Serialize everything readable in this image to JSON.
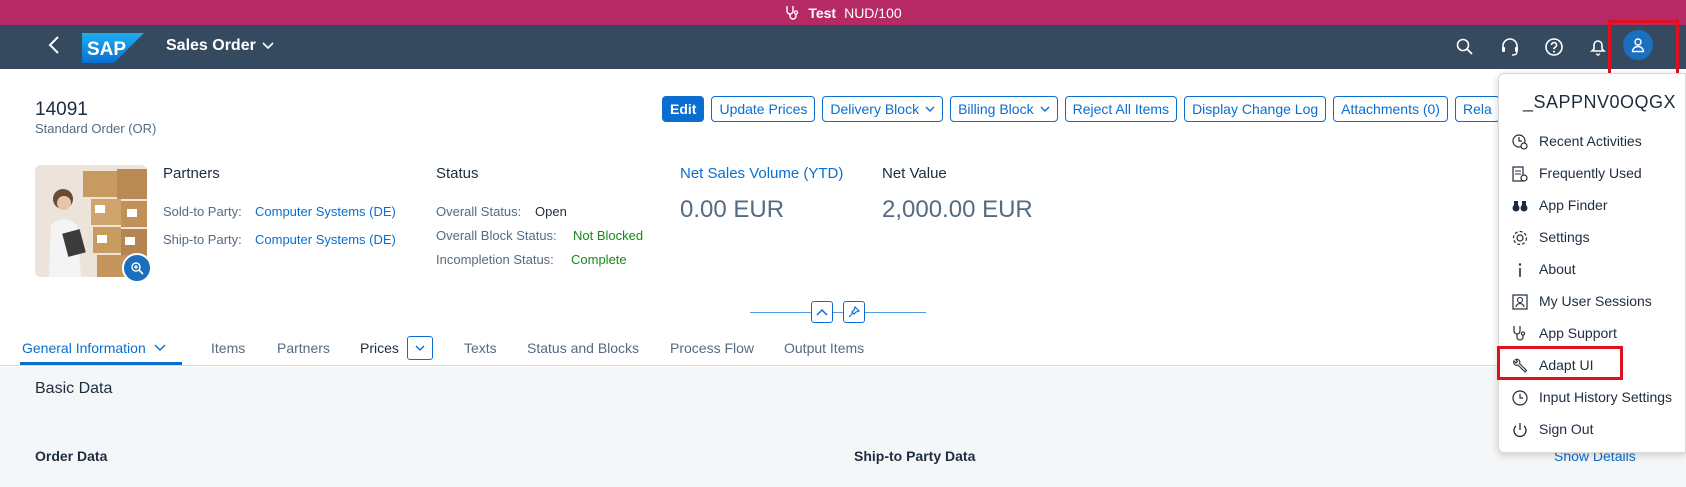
{
  "system_bar": {
    "label": "Test",
    "client": "NUD/100"
  },
  "shell": {
    "app_title": "Sales Order",
    "icons": [
      "back-icon",
      "sap-logo",
      "search-icon",
      "support-icon",
      "help-icon",
      "notifications-icon",
      "user-icon"
    ],
    "logo_text": "SAP"
  },
  "header": {
    "object_id": "14091",
    "object_type": "Standard Order (OR)",
    "actions": [
      {
        "label": "Edit",
        "emphasized": true
      },
      {
        "label": "Update Prices"
      },
      {
        "label": "Delivery Block",
        "dropdown": true
      },
      {
        "label": "Billing Block",
        "dropdown": true
      },
      {
        "label": "Reject All Items"
      },
      {
        "label": "Display Change Log"
      },
      {
        "label": "Attachments (0)"
      },
      {
        "label": "Rela"
      }
    ],
    "partners": {
      "title": "Partners",
      "sold_to_label": "Sold-to Party:",
      "sold_to_value": "Computer Systems (DE)",
      "ship_to_label": "Ship-to Party:",
      "ship_to_value": "Computer Systems (DE)"
    },
    "status": {
      "title": "Status",
      "overall_label": "Overall Status:",
      "overall_value": "Open",
      "block_label": "Overall Block Status:",
      "block_value": "Not Blocked",
      "incompletion_label": "Incompletion Status:",
      "incompletion_value": "Complete"
    },
    "kpi_net_sales": {
      "title": "Net Sales Volume (YTD)",
      "value": "0.00",
      "unit": "EUR"
    },
    "kpi_net_value": {
      "title": "Net Value",
      "value": "2,000.00",
      "unit": "EUR"
    }
  },
  "tabs": [
    {
      "label": "General Information",
      "active": true
    },
    {
      "label": "Items"
    },
    {
      "label": "Partners"
    },
    {
      "label": "Prices"
    },
    {
      "label": "Texts"
    },
    {
      "label": "Status and Blocks"
    },
    {
      "label": "Process Flow"
    },
    {
      "label": "Output Items"
    }
  ],
  "section": {
    "title": "Basic Data",
    "order_data": "Order Data",
    "ship_to_data": "Ship-to Party Data",
    "show_details": "Show Details"
  },
  "user_menu": {
    "user_name": "_SAPPNV0OQGX",
    "items": [
      {
        "label": "Recent Activities",
        "icon": "recent-activities-icon"
      },
      {
        "label": "Frequently Used",
        "icon": "frequently-used-icon"
      },
      {
        "label": "App Finder",
        "icon": "binoculars-icon"
      },
      {
        "label": "Settings",
        "icon": "gear-icon"
      },
      {
        "label": "About",
        "icon": "info-icon"
      },
      {
        "label": "My User Sessions",
        "icon": "user-sessions-icon"
      },
      {
        "label": "App Support",
        "icon": "stethoscope-icon"
      },
      {
        "label": "Adapt UI",
        "icon": "wrench-icon"
      },
      {
        "label": "Input History Settings",
        "icon": "history-icon"
      },
      {
        "label": "Sign Out",
        "icon": "power-icon"
      }
    ]
  },
  "colors": {
    "system_bar": "#b52965",
    "shell": "#354a5f",
    "brand_blue": "#0a6ed1",
    "positive": "#188918",
    "highlight": "#e0101f"
  }
}
